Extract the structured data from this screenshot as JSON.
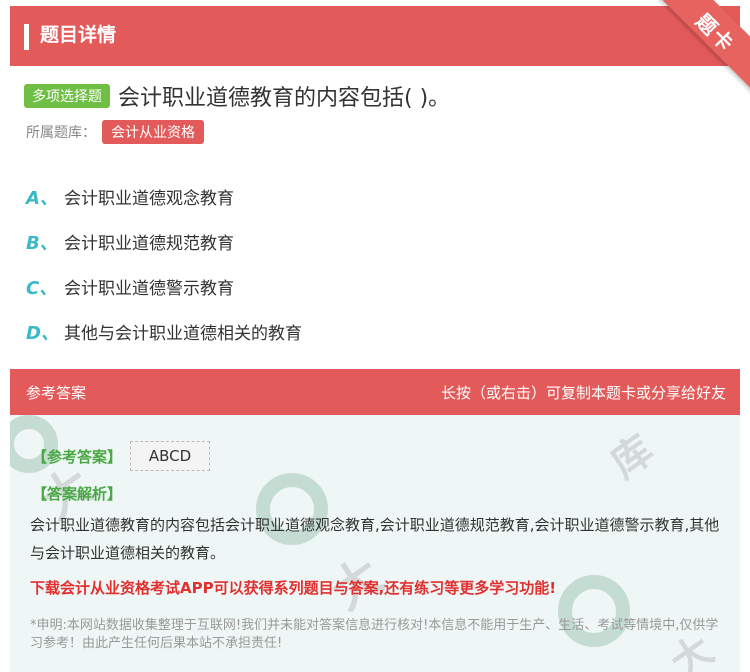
{
  "header": {
    "title": "题目详情",
    "corner_badge": "题卡"
  },
  "question": {
    "type_tag": "多项选择题",
    "text": "会计职业道德教育的内容包括( )。",
    "bank_label": "所属题库：",
    "bank_tag": "会计从业资格"
  },
  "options": [
    {
      "letter": "A、",
      "text": "会计职业道德观念教育"
    },
    {
      "letter": "B、",
      "text": "会计职业道德规范教育"
    },
    {
      "letter": "C、",
      "text": "会计职业道德警示教育"
    },
    {
      "letter": "D、",
      "text": "其他与会计职业道德相关的教育"
    }
  ],
  "answer_section": {
    "title": "参考答案",
    "hint": "长按（或右击）可复制本题卡或分享给好友",
    "answer_label": "【参考答案】",
    "answer_value": "ABCD",
    "analysis_label": "【答案解析】",
    "analysis_text": "会计职业道德教育的内容包括会计职业道德观念教育,会计职业道德规范教育,会计职业道德警示教育,其他与会计职业道德相关的教育。",
    "promo": "下载会计从业资格考试APP可以获得系列题目与答案,还有练习等更多学习功能!",
    "disclaimer": "*申明:本网站数据收集整理于互联网!我们并未能对答案信息进行核对!本信息不能用于生产、生活、考试等情境中,仅供学习参考！由此产生任何后果本站不承担责任!"
  },
  "colors": {
    "red": "#e35a5a",
    "green": "#6fbf45",
    "teal": "#3cb9c6",
    "promo_red": "#e03030"
  }
}
